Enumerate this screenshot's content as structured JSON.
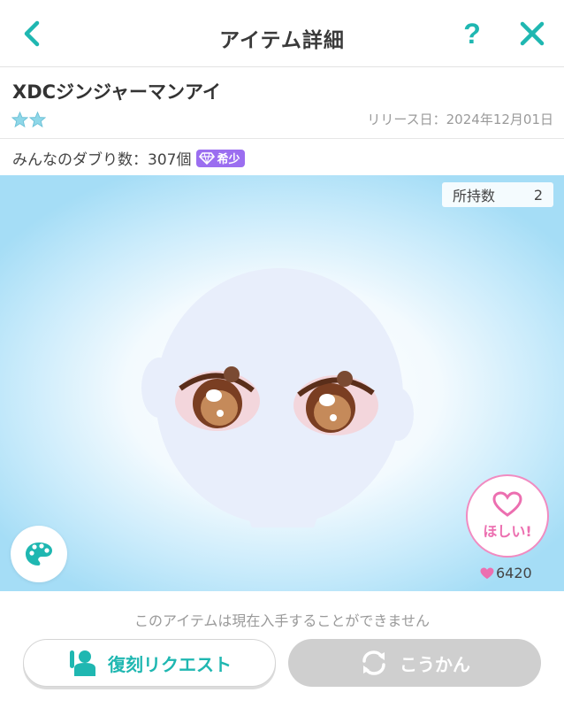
{
  "header": {
    "title": "アイテム詳細",
    "back_icon": "chevron-left-icon",
    "help_label": "?",
    "close_icon": "close-icon",
    "accent_color": "#1fb7b1"
  },
  "item": {
    "name": "XDCジンジャーマンアイ",
    "stars": 2,
    "release": "リリース日：2024年12月01日",
    "duplicates": "みんなのダブり数：307個",
    "rarity_badge": "希少",
    "owned_label": "所持数",
    "owned_count": "2"
  },
  "actions": {
    "want_label": "ほしい!",
    "likes": "6420",
    "notice": "このアイテムは現在入手することができません",
    "request_label": "復刻リクエスト",
    "trade_label": "こうかん"
  }
}
